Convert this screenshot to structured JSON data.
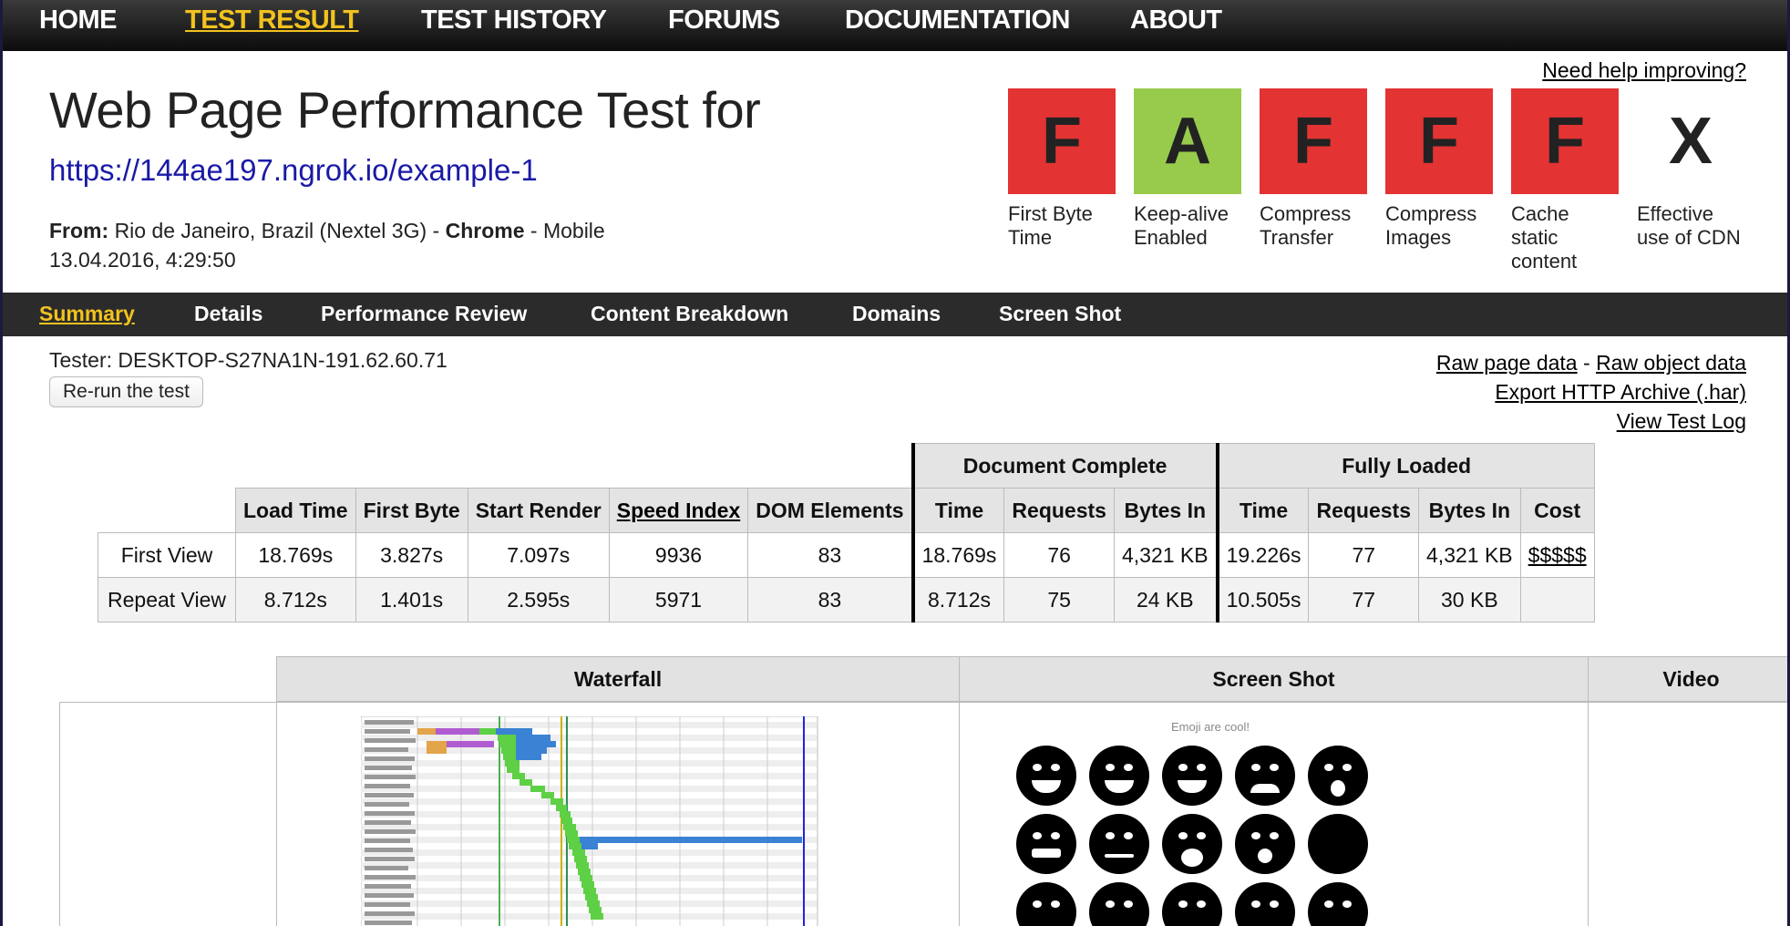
{
  "nav": {
    "items": [
      "HOME",
      "TEST RESULT",
      "TEST HISTORY",
      "FORUMS",
      "DOCUMENTATION",
      "ABOUT"
    ],
    "active": "TEST RESULT"
  },
  "header": {
    "help_link": "Need help improving?",
    "title": "Web Page Performance Test for",
    "url": "https://144ae197.ngrok.io/example-1",
    "from_label": "From:",
    "location": "Rio de Janeiro, Brazil (Nextel 3G)",
    "separator": "-",
    "browser": "Chrome",
    "device": "Mobile",
    "date": "13.04.2016, 4:29:50"
  },
  "grades": [
    {
      "grade": "F",
      "label": "First Byte Time",
      "color": "#e33333"
    },
    {
      "grade": "A",
      "label": "Keep-alive Enabled",
      "color": "#98cb4c"
    },
    {
      "grade": "F",
      "label": "Compress Transfer",
      "color": "#e33333"
    },
    {
      "grade": "F",
      "label": "Compress Images",
      "color": "#e33333"
    },
    {
      "grade": "F",
      "label": "Cache static content",
      "color": "#e33333"
    },
    {
      "grade": "X",
      "label": "Effective use of CDN",
      "color": "#ffffff"
    }
  ],
  "subnav": {
    "items": [
      "Summary",
      "Details",
      "Performance Review",
      "Content Breakdown",
      "Domains",
      "Screen Shot"
    ],
    "active": "Summary"
  },
  "tester": {
    "text": "Tester: DESKTOP-S27NA1N-191.62.60.71",
    "rerun_label": "Re-run the test"
  },
  "links": {
    "raw_page": "Raw page data",
    "dash": "-",
    "raw_object": "Raw object data",
    "har": "Export HTTP Archive (.har)",
    "log": "View Test Log"
  },
  "results": {
    "group_headers": [
      "Document Complete",
      "Fully Loaded"
    ],
    "columns": [
      "Load Time",
      "First Byte",
      "Start Render",
      "Speed Index",
      "DOM Elements",
      "Time",
      "Requests",
      "Bytes In",
      "Time",
      "Requests",
      "Bytes In",
      "Cost"
    ],
    "rows": [
      {
        "label": "First View",
        "values": [
          "18.769s",
          "3.827s",
          "7.097s",
          "9936",
          "83",
          "18.769s",
          "76",
          "4,321 KB",
          "19.226s",
          "77",
          "4,321 KB",
          "$$$$$"
        ]
      },
      {
        "label": "Repeat View",
        "values": [
          "8.712s",
          "1.401s",
          "2.595s",
          "5971",
          "83",
          "8.712s",
          "75",
          "24 KB",
          "10.505s",
          "77",
          "30 KB",
          ""
        ]
      }
    ]
  },
  "media": {
    "headers": [
      "Waterfall",
      "Screen Shot",
      "Video"
    ],
    "screenshot_caption": "Emoji are cool!"
  }
}
